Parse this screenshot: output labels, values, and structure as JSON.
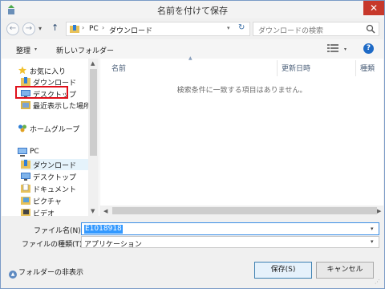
{
  "window": {
    "title": "名前を付けて保存",
    "close_glyph": "✕"
  },
  "nav": {
    "back_glyph": "←",
    "forward_glyph": "→",
    "history_glyph": "▾",
    "up_glyph": "↑"
  },
  "address": {
    "segments": [
      "PC",
      "ダウンロード"
    ],
    "sep_glyph": "›",
    "dropdown_glyph": "▾",
    "refresh_glyph": "↻"
  },
  "search": {
    "placeholder": "ダウンロードの検索"
  },
  "toolbar": {
    "organize_label": "整理",
    "dropdown_glyph": "▾",
    "new_folder_label": "新しいフォルダー",
    "help_glyph": "?"
  },
  "sidebar": {
    "items": [
      {
        "label": "お気に入り",
        "icon": "star-icon"
      },
      {
        "label": "ダウンロード",
        "icon": "downloads-folder-icon"
      },
      {
        "label": "デスクトップ",
        "icon": "desktop-icon"
      },
      {
        "label": "最近表示した場所",
        "icon": "recent-places-icon"
      },
      {
        "label": "ホームグループ",
        "icon": "homegroup-icon"
      },
      {
        "label": "PC",
        "icon": "pc-icon"
      },
      {
        "label": "ダウンロード",
        "icon": "downloads-folder-icon"
      },
      {
        "label": "デスクトップ",
        "icon": "desktop-icon"
      },
      {
        "label": "ドキュメント",
        "icon": "documents-icon"
      },
      {
        "label": "ピクチャ",
        "icon": "pictures-icon"
      },
      {
        "label": "ビデオ",
        "icon": "videos-icon"
      }
    ]
  },
  "columns": {
    "name": "名前",
    "modified": "更新日時",
    "type": "種類"
  },
  "empty_message": "検索条件に一致する項目はありません。",
  "scroll": {
    "up": "▲",
    "down": "▼",
    "left": "◀",
    "right": "▶"
  },
  "form": {
    "filename_label": "ファイル名(N):",
    "filename_value": "E1018918",
    "filetype_label": "ファイルの種類(T):",
    "filetype_value": "アプリケーション",
    "dropdown_glyph": "▾"
  },
  "footer": {
    "hide_folders_label": "フォルダーの非表示",
    "hide_folders_glyph": "▲",
    "save_label": "保存(S)",
    "cancel_label": "キャンセル",
    "grip_glyph": "⋰"
  },
  "colors": {
    "accent": "#3399ff",
    "highlight": "#e0101b",
    "close": "#c7382b",
    "help": "#1e6ac6"
  }
}
